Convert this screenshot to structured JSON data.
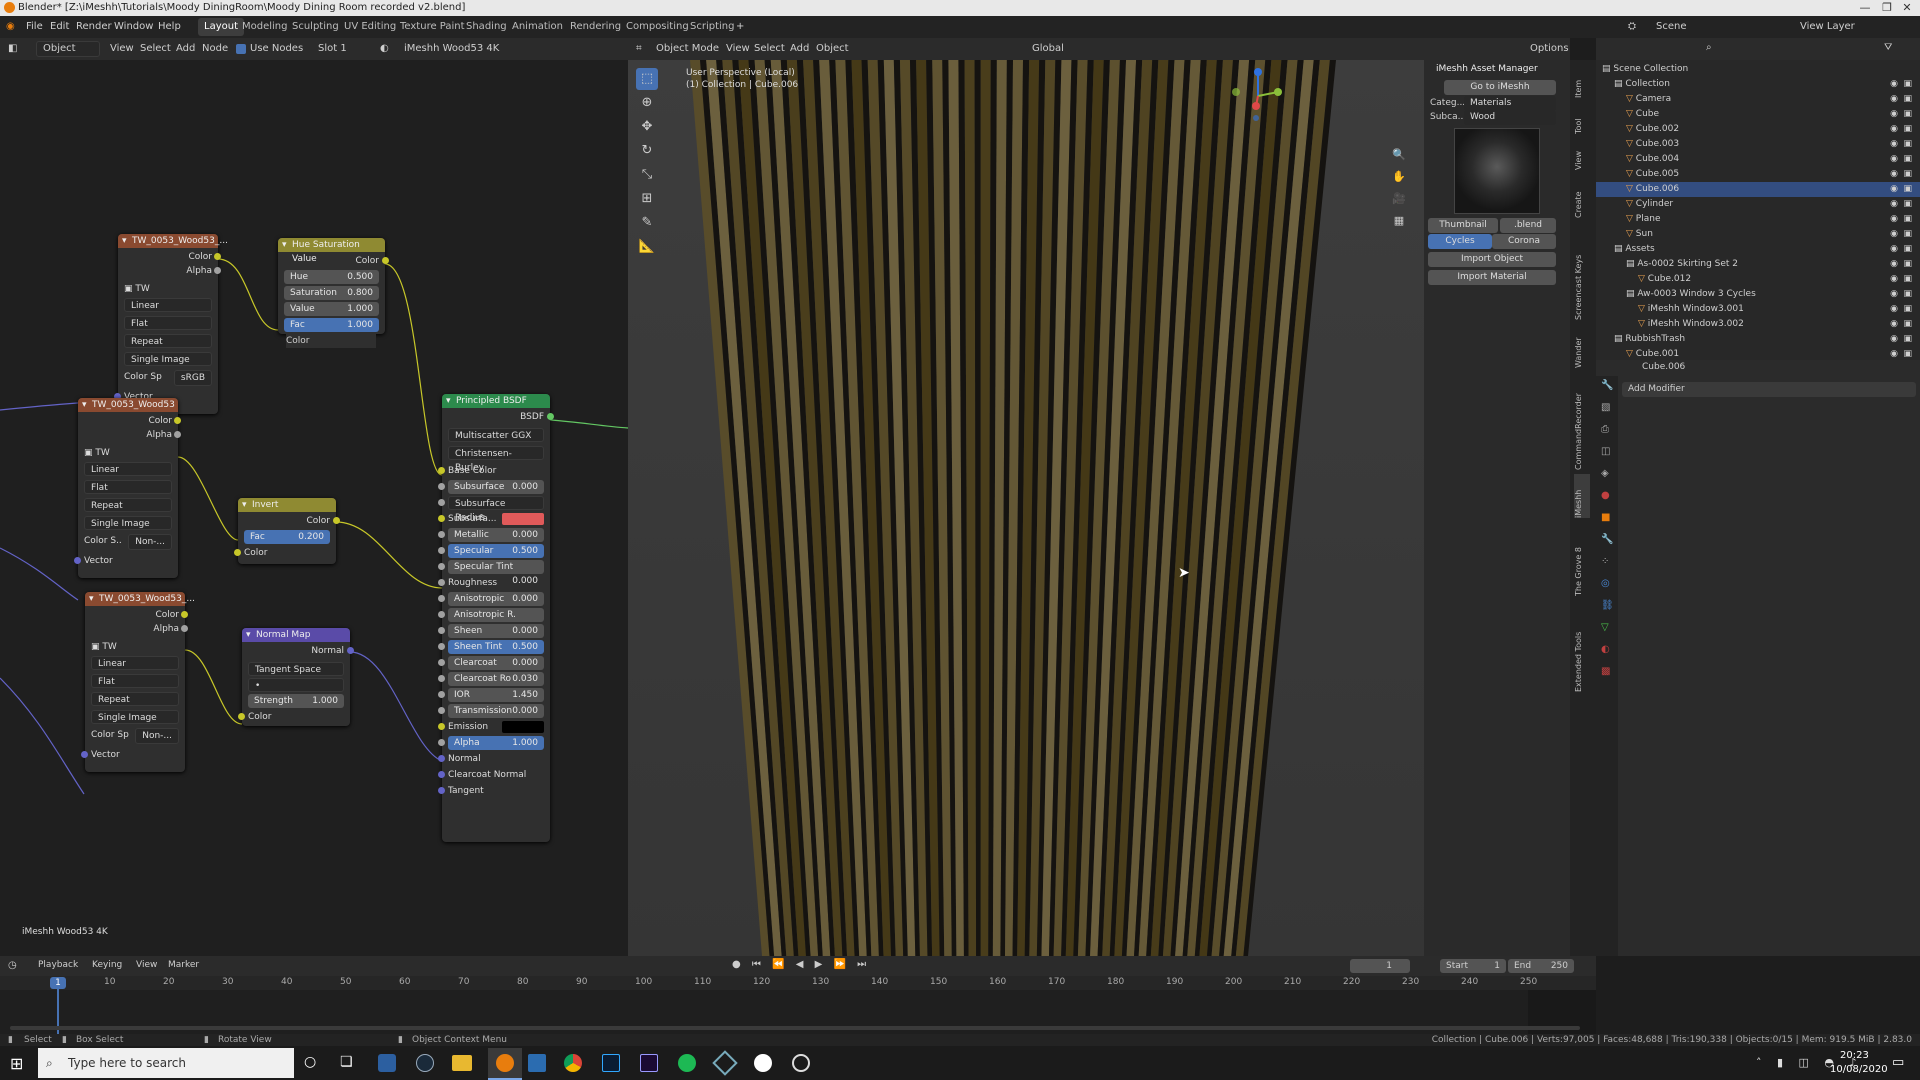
{
  "window": {
    "title": "Blender* [Z:\\iMeshh\\Tutorials\\Moody DiningRoom\\Moody Dining Room recorded v2.blend]",
    "controls": [
      "—",
      "❐",
      "✕"
    ]
  },
  "menu": {
    "items": [
      "File",
      "Edit",
      "Render",
      "Window",
      "Help"
    ],
    "workspaces": [
      "Layout",
      "Modeling",
      "Sculpting",
      "UV Editing",
      "Texture Paint",
      "Shading",
      "Animation",
      "Rendering",
      "Compositing",
      "Scripting"
    ],
    "add_tab": "+",
    "scene": "Scene",
    "view_layer": "View Layer"
  },
  "node_editor": {
    "header": {
      "mode": "Object",
      "view": "View",
      "select": "Select",
      "add": "Add",
      "node": "Node",
      "use_nodes": "Use Nodes",
      "slot": "Slot 1",
      "material": "iMeshh Wood53 4K"
    },
    "material_label": "iMeshh Wood53 4K",
    "tex1": {
      "title": "TW_0053_Wood53_...",
      "color": "Color",
      "alpha": "Alpha",
      "tw": "TW",
      "interp": "Linear",
      "proj": "Flat",
      "ext": "Repeat",
      "src": "Single Image",
      "cs_label": "Color Sp",
      "cs_val": "sRGB",
      "vector": "Vector"
    },
    "tex2": {
      "title": "TW_0053_Wood53",
      "color": "Color",
      "alpha": "Alpha",
      "tw": "TW",
      "interp": "Linear",
      "proj": "Flat",
      "ext": "Repeat",
      "src": "Single Image",
      "cs_label": "Color S..",
      "cs_val": "Non-...",
      "vector": "Vector"
    },
    "tex3": {
      "title": "TW_0053_Wood53_...",
      "color": "Color",
      "alpha": "Alpha",
      "tw": "TW",
      "interp": "Linear",
      "proj": "Flat",
      "ext": "Repeat",
      "src": "Single Image",
      "cs_label": "Color Sp",
      "cs_val": "Non-...",
      "vector": "Vector"
    },
    "hsv": {
      "title": "Hue Saturation Value",
      "color_out": "Color",
      "hue_l": "Hue",
      "hue_v": "0.500",
      "sat_l": "Saturation",
      "sat_v": "0.800",
      "val_l": "Value",
      "val_v": "1.000",
      "fac_l": "Fac",
      "fac_v": "1.000",
      "color_in": "Color"
    },
    "invert": {
      "title": "Invert",
      "color_out": "Color",
      "fac_l": "Fac",
      "fac_v": "0.200",
      "color_in": "Color"
    },
    "normal": {
      "title": "Normal Map",
      "normal_out": "Normal",
      "space": "Tangent Space",
      "uv": "•",
      "str_l": "Strength",
      "str_v": "1.000",
      "color_in": "Color"
    },
    "bsdf": {
      "title": "Principled BSDF",
      "out": "BSDF",
      "dist": "Multiscatter GGX",
      "sss": "Christensen-Burley",
      "base_color": "Base Color",
      "fields": [
        {
          "l": "Subsurface",
          "v": "0.000",
          "hl": false
        },
        {
          "l": "Subsurface Radius",
          "v": "",
          "hl": false,
          "sel": true
        },
        {
          "l": "Subsurfa...",
          "v": "",
          "hl": false,
          "swatch": "#e05a5a"
        },
        {
          "l": "Metallic",
          "v": "0.000",
          "hl": false
        },
        {
          "l": "Specular",
          "v": "0.500",
          "hl": true
        },
        {
          "l": "Specular Tint",
          "v": "0.000",
          "hl": false
        },
        {
          "l": "Roughness",
          "v": "",
          "hl": false,
          "plain": true
        },
        {
          "l": "Anisotropic",
          "v": "0.000",
          "hl": false
        },
        {
          "l": "Anisotropic R.",
          "v": "0.000",
          "hl": false
        },
        {
          "l": "Sheen",
          "v": "0.000",
          "hl": false
        },
        {
          "l": "Sheen Tint",
          "v": "0.500",
          "hl": true
        },
        {
          "l": "Clearcoat",
          "v": "0.000",
          "hl": false
        },
        {
          "l": "Clearcoat Ro",
          "v": "0.030",
          "hl": false
        },
        {
          "l": "IOR",
          "v": "1.450",
          "hl": false
        },
        {
          "l": "Transmission",
          "v": "0.000",
          "hl": false
        },
        {
          "l": "Emission",
          "v": "",
          "hl": false,
          "swatch": "#000000"
        },
        {
          "l": "Alpha",
          "v": "1.000",
          "hl": true
        },
        {
          "l": "Normal",
          "v": "",
          "plain": true
        },
        {
          "l": "Clearcoat Normal",
          "v": "",
          "plain": true
        },
        {
          "l": "Tangent",
          "v": "",
          "plain": true
        }
      ]
    }
  },
  "viewport": {
    "header": {
      "mode": "Object Mode",
      "view": "View",
      "select": "Select",
      "add": "Add",
      "object": "Object",
      "orient": "Global",
      "options": "Options"
    },
    "info1": "User Perspective (Local)",
    "info2": "(1) Collection | Cube.006",
    "tabs": [
      "Item",
      "Tool",
      "View",
      "Create",
      "Screencast Keys",
      "Wander",
      "CommandRecorder",
      "iMeshh",
      "The Grove 8",
      "Extended Tools"
    ]
  },
  "asset_manager": {
    "title": "iMeshh Asset Manager",
    "goto": "Go to iMeshh",
    "cat_l": "Categ...",
    "cat_v": "Materials",
    "sub_l": "Subca...",
    "sub_v": "Wood",
    "thumb_btn": "Thumbnail",
    "blend_btn": ".blend",
    "engine1": "Cycles",
    "engine2": "Corona",
    "import_obj": "Import Object",
    "import_mat": "Import Material"
  },
  "outliner": {
    "header": "Scene Collection",
    "rows": [
      {
        "name": "Collection",
        "indent": 1,
        "kind": "coll"
      },
      {
        "name": "Camera",
        "indent": 2,
        "kind": "obj"
      },
      {
        "name": "Cube",
        "indent": 2,
        "kind": "obj"
      },
      {
        "name": "Cube.002",
        "indent": 2,
        "kind": "obj"
      },
      {
        "name": "Cube.003",
        "indent": 2,
        "kind": "obj"
      },
      {
        "name": "Cube.004",
        "indent": 2,
        "kind": "obj"
      },
      {
        "name": "Cube.005",
        "indent": 2,
        "kind": "obj"
      },
      {
        "name": "Cube.006",
        "indent": 2,
        "kind": "obj"
      },
      {
        "name": "Cylinder",
        "indent": 2,
        "kind": "obj"
      },
      {
        "name": "Plane",
        "indent": 2,
        "kind": "obj"
      },
      {
        "name": "Sun",
        "indent": 2,
        "kind": "obj"
      },
      {
        "name": "Assets",
        "indent": 1,
        "kind": "coll"
      },
      {
        "name": "As-0002 Skirting Set 2",
        "indent": 2,
        "kind": "coll"
      },
      {
        "name": "Cube.012",
        "indent": 3,
        "kind": "obj"
      },
      {
        "name": "Aw-0003 Window 3 Cycles",
        "indent": 2,
        "kind": "coll"
      },
      {
        "name": "iMeshh Window3.001",
        "indent": 3,
        "kind": "obj"
      },
      {
        "name": "iMeshh Window3.002",
        "indent": 3,
        "kind": "obj"
      },
      {
        "name": "RubbishTrash",
        "indent": 1,
        "kind": "coll"
      },
      {
        "name": "Cube.001",
        "indent": 2,
        "kind": "obj"
      }
    ]
  },
  "properties": {
    "object": "Cube.006",
    "add_modifier": "Add Modifier"
  },
  "timeline": {
    "menus": [
      "Playback",
      "Keying",
      "View",
      "Marker"
    ],
    "current": "1",
    "start_l": "Start",
    "start_v": "1",
    "end_l": "End",
    "end_v": "250",
    "ticks": [
      "10",
      "20",
      "30",
      "40",
      "50",
      "60",
      "70",
      "80",
      "90",
      "100",
      "110",
      "120",
      "130",
      "140",
      "150",
      "160",
      "170",
      "180",
      "190",
      "200",
      "210",
      "220",
      "230",
      "240",
      "250"
    ],
    "frame_marker": "1"
  },
  "status": {
    "select": "Select",
    "box": "Box Select",
    "rotate": "Rotate View",
    "ctx": "Object Context Menu",
    "stats": "Collection | Cube.006 | Verts:97,005 | Faces:48,688 | Tris:190,338 | Objects:0/15 | Mem: 919.5 MiB | 2.83.0"
  },
  "taskbar": {
    "search": "Type here to search",
    "time": "20:23",
    "date": "10/08/2020"
  }
}
